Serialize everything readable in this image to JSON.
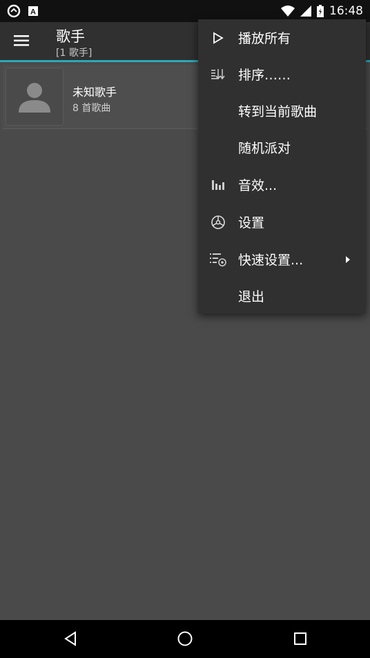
{
  "status_bar": {
    "time": "16:48",
    "left_icons": [
      "sync-icon",
      "a-icon"
    ],
    "right_icons": [
      "wifi-icon",
      "signal-icon",
      "battery-icon"
    ]
  },
  "app_bar": {
    "title": "歌手",
    "subtitle": "[1 歌手]",
    "accent_color": "#2ea9b7"
  },
  "list": {
    "items": [
      {
        "title": "未知歌手",
        "subtitle": "8 首歌曲",
        "icon": "person-avatar-icon"
      }
    ]
  },
  "overflow_menu": {
    "items": [
      {
        "label": "播放所有",
        "icon": "play-icon"
      },
      {
        "label": "排序……",
        "icon": "sort-icon"
      },
      {
        "label": "转到当前歌曲",
        "icon": ""
      },
      {
        "label": "随机派对",
        "icon": ""
      },
      {
        "label": "音效...",
        "icon": "equalizer-icon"
      },
      {
        "label": "设置",
        "icon": "settings-icon"
      },
      {
        "label": "快速设置...",
        "icon": "quick-settings-icon",
        "has_submenu": true
      },
      {
        "label": "退出",
        "icon": ""
      }
    ]
  },
  "nav_bar": {
    "buttons": [
      "back-icon",
      "home-icon",
      "recents-icon"
    ]
  }
}
